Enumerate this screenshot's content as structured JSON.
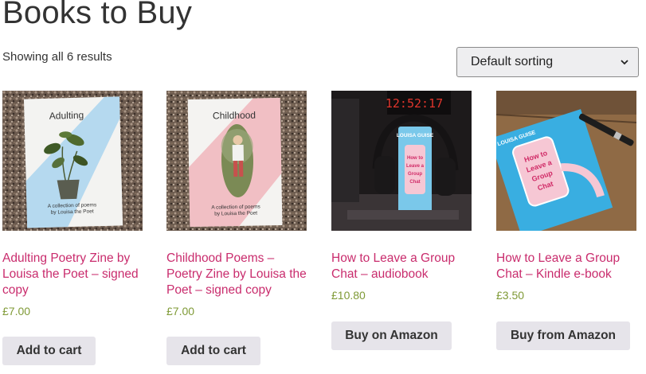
{
  "page": {
    "title": "Books to Buy",
    "result_count": "Showing all 6 results",
    "sort": {
      "selected": "Default sorting"
    }
  },
  "products": [
    {
      "title": "Adulting Poetry Zine by Louisa the Poet – signed copy",
      "price": "£7.00",
      "button": "Add to cart",
      "cover_title": "Adulting",
      "cover_line1": "A collection of poems",
      "cover_line2": "by Louisa the Poet"
    },
    {
      "title": "Childhood Poems – Poetry Zine by Louisa the Poet – signed copy",
      "price": "£7.00",
      "button": "Add to cart",
      "cover_title": "Childhood",
      "cover_line1": "A collection of poems",
      "cover_line2": "by Louisa the Poet"
    },
    {
      "title": "How to Leave a Group Chat – audiobook",
      "price": "£10.80",
      "button": "Buy on Amazon",
      "clock": "12:52:17",
      "book_author": "LOUISA GUISE",
      "book_title": "How to Leave a Group Chat"
    },
    {
      "title": "How to Leave a Group Chat – Kindle e-book",
      "price": "£3.50",
      "button": "Buy from Amazon",
      "book_author": "LOUISA GUISE",
      "book_title": "How to Leave a Group Chat"
    }
  ],
  "colors": {
    "link": "#c92c6d",
    "price": "#7f9a36",
    "button_bg": "#e6e4ea"
  }
}
